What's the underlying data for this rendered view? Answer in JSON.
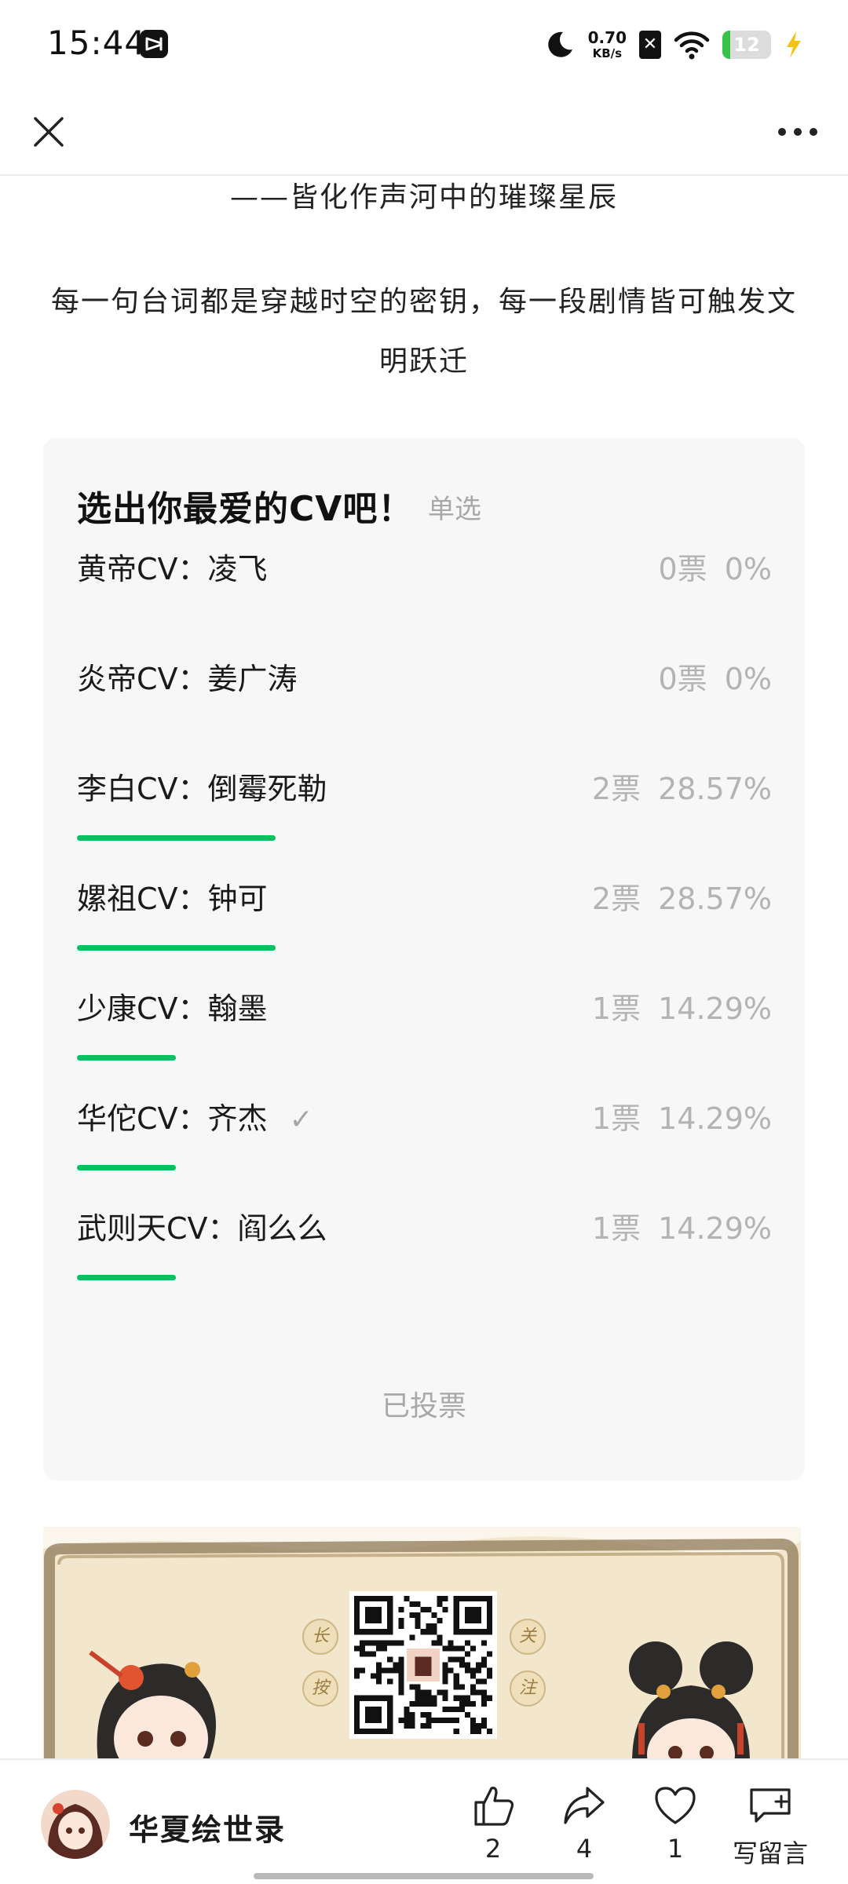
{
  "status_bar": {
    "time": "15:44",
    "net_speed_value": "0.70",
    "net_speed_unit": "KB/s",
    "sim_mark": "✕",
    "battery": "12"
  },
  "article": {
    "line_top": "——皆化作声河中的璀璨星辰",
    "paragraph": "每一句台词都是穿越时空的密钥，每一段剧情皆可触发文明跃迁"
  },
  "vote": {
    "title": "选出你最爱的CV吧！",
    "type": "单选",
    "options": [
      {
        "label": "黄帝CV：凌飞",
        "votes": "0票",
        "percent": "0%",
        "selected": false,
        "share": 0
      },
      {
        "label": "炎帝CV：姜广涛",
        "votes": "0票",
        "percent": "0%",
        "selected": false,
        "share": 0
      },
      {
        "label": "李白CV：倒霉死勒",
        "votes": "2票",
        "percent": "28.57%",
        "selected": false,
        "share": 0.2857
      },
      {
        "label": "嫘祖CV：钟可",
        "votes": "2票",
        "percent": "28.57%",
        "selected": false,
        "share": 0.2857
      },
      {
        "label": "少康CV：翰墨",
        "votes": "1票",
        "percent": "14.29%",
        "selected": false,
        "share": 0.1429
      },
      {
        "label": "华佗CV：齐杰",
        "votes": "1票",
        "percent": "14.29%",
        "selected": true,
        "share": 0.1429
      },
      {
        "label": "武则天CV：阎么么",
        "votes": "1票",
        "percent": "14.29%",
        "selected": false,
        "share": 0.1429
      }
    ],
    "status": "已投票",
    "check_mark": "✓"
  },
  "banner": {
    "seals": [
      "长",
      "按",
      "关",
      "注"
    ]
  },
  "bottom_bar": {
    "author": "华夏绘世录",
    "like_count": "2",
    "share_count": "4",
    "favorite_count": "1",
    "comment_label": "写留言"
  },
  "colors": {
    "accent": "#07c160",
    "muted": "#a8a8a8",
    "card_bg": "#f7f7f7"
  },
  "icons": [
    "close-icon",
    "more-icon",
    "check-icon",
    "like-icon",
    "share-icon",
    "favorite-icon",
    "comment-icon"
  ]
}
